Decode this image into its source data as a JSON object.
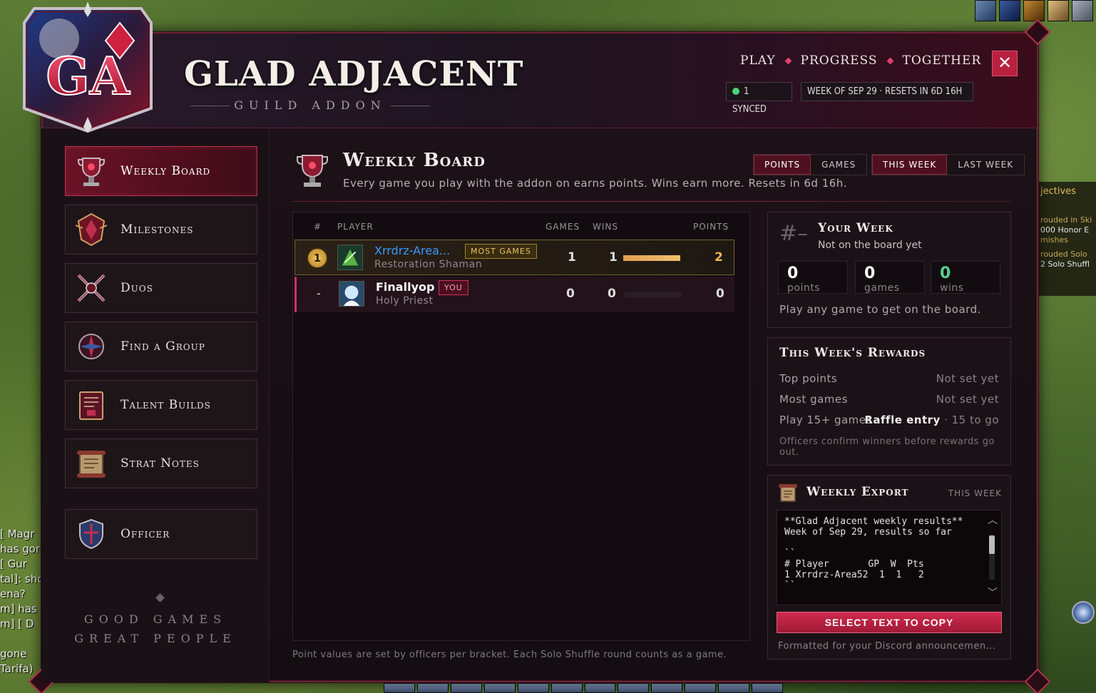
{
  "app": {
    "logo_text": "GA",
    "title": "GLAD ADJACENT",
    "subtitle": "GUILD ADDON",
    "tagline": [
      "PLAY",
      "PROGRESS",
      "TOGETHER"
    ],
    "close_label": "✕",
    "sync_status": "1 SYNCED",
    "week_info": "WEEK OF SEP 29 · RESETS IN 6D 16H"
  },
  "sidebar": {
    "items": [
      {
        "label": "Weekly Board",
        "icon": "trophy-icon",
        "active": true
      },
      {
        "label": "Milestones",
        "icon": "crest-icon",
        "active": false
      },
      {
        "label": "Duos",
        "icon": "crossed-swords-icon",
        "active": false
      },
      {
        "label": "Find a Group",
        "icon": "compass-icon",
        "active": false
      },
      {
        "label": "Talent Builds",
        "icon": "book-icon",
        "active": false
      },
      {
        "label": "Strat Notes",
        "icon": "scroll-icon",
        "active": false
      },
      {
        "label": "Officer",
        "icon": "shield-icon",
        "active": false
      }
    ],
    "footer_line1": "GOOD GAMES",
    "footer_line2": "GREAT PEOPLE"
  },
  "main": {
    "title": "Weekly Board",
    "description": "Every game you play with the addon on earns points. Wins earn more. Resets in 6d 16h.",
    "metric_toggle": [
      {
        "label": "POINTS",
        "selected": true
      },
      {
        "label": "GAMES",
        "selected": false
      }
    ],
    "week_toggle": [
      {
        "label": "THIS WEEK",
        "selected": true
      },
      {
        "label": "LAST WEEK",
        "selected": false
      }
    ],
    "table": {
      "headers": {
        "rank": "#",
        "player": "PLAYER",
        "games": "GAMES",
        "wins": "WINS",
        "points": "POINTS"
      },
      "rows": [
        {
          "rank": "1",
          "name": "Xrrdrz-Area...",
          "class": "Restoration Shaman",
          "tag": "MOST GAMES",
          "games": "1",
          "wins": "1",
          "points": "2",
          "bar_fraction": 1.0
        },
        {
          "rank": "-",
          "name": "Finallyop",
          "class": "Holy Priest",
          "tag": "YOU",
          "games": "0",
          "wins": "0",
          "points": "0",
          "bar_fraction": 0.0
        }
      ],
      "footnote": "Point values are set by officers per bracket. Each Solo Shuffle round counts as a game."
    }
  },
  "your_week": {
    "rank": "#–",
    "title": "Your Week",
    "status": "Not on the board yet",
    "stats": [
      {
        "value": "0",
        "label": "points"
      },
      {
        "value": "0",
        "label": "games"
      },
      {
        "value": "0",
        "label": "wins"
      }
    ],
    "hint": "Play any game to get on the board."
  },
  "rewards": {
    "title": "This Week's Rewards",
    "rows": [
      {
        "label": "Top points",
        "value": "Not set yet"
      },
      {
        "label": "Most games",
        "value": "Not set yet"
      },
      {
        "label": "Play 15+ games",
        "value_bold": "Raffle entry",
        "value": " · 15 to go"
      }
    ],
    "note": "Officers confirm winners before rewards go out."
  },
  "export": {
    "title": "Weekly Export",
    "scope": "THIS WEEK",
    "text": "**Glad Adjacent weekly results**\nWeek of Sep 29, results so far\n\n``\n# Player       GP  W  Pts\n1 Xrrdrz-Area52  1  1   2\n``",
    "button": "SELECT TEXT TO COPY",
    "caption": "Formatted for your Discord announcemen..."
  },
  "world": {
    "chat_lines": [
      "[ Magr",
      "has gor",
      "[ Gur",
      "tal]: sho",
      "ena?",
      "m] has",
      "m] [ D",
      "",
      "gone",
      "Tarifa)"
    ],
    "right_panel_head": "jectives",
    "right_panel_lines": [
      "rouded in Ski",
      "000 Honor E",
      "mishes",
      "rouded Solo",
      "2 Solo Shuffl"
    ]
  },
  "colors": {
    "accent": "#c0304e",
    "gold": "#e8c260",
    "green": "#5ad08a",
    "link": "#3a9aff"
  }
}
